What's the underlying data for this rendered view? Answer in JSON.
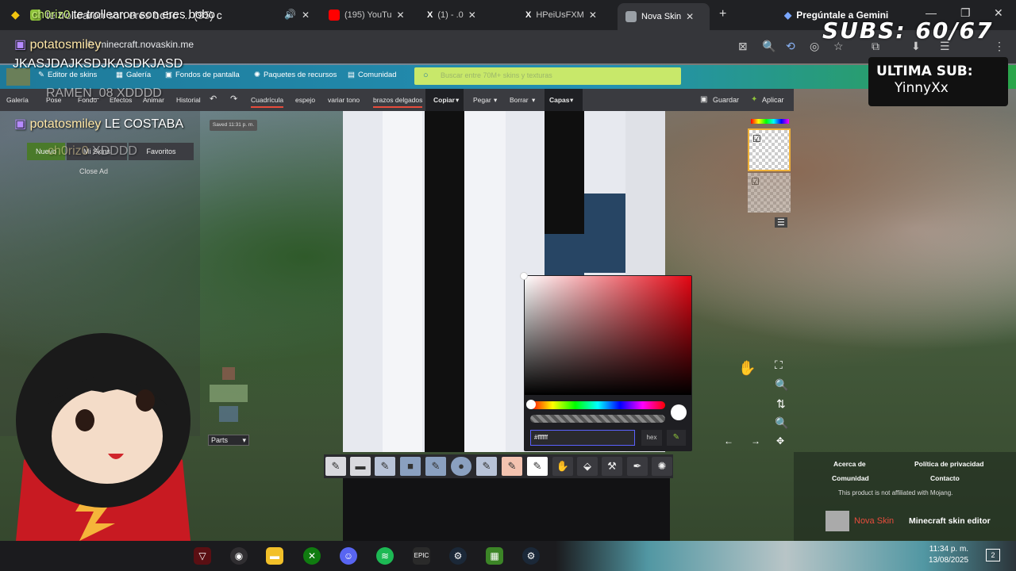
{
  "browser": {
    "tabs": [
      {
        "label": "te trollearon son eres bobo ... (95) c",
        "icon": "audio-tab-icon"
      },
      {
        "label": "(195) YouTu",
        "icon": "youtube-icon"
      },
      {
        "label": "(1) - .0",
        "icon": "x-icon"
      },
      {
        "label": "HPeiUsFXM",
        "icon": "x-icon"
      },
      {
        "label": "Nova Skin",
        "icon": "nova-skin-icon",
        "active": true
      },
      {
        "label": "Pregúntale a Gemini",
        "icon": "gemini-icon"
      }
    ],
    "url": "minecraft.novaskin.me"
  },
  "site_nav": {
    "items": [
      "Editor de skins",
      "Galería",
      "Fondos de pantalla",
      "Paquetes de recursos",
      "Comunidad"
    ],
    "search_placeholder": "Buscar entre 70M+ skins y texturas"
  },
  "editor_toolbar": {
    "left_items": [
      "Galería",
      "Pose",
      "Fondo",
      "Efectos",
      "Animar",
      "Historial"
    ],
    "undo": "↶",
    "redo": "↷",
    "items": [
      "Cuadrícula",
      "espejo",
      "variar tono",
      "brazos delgados"
    ],
    "menus": [
      "Copiar",
      "Pegar",
      "Borrar",
      "Capas"
    ],
    "save": "Guardar",
    "apply": "Aplicar"
  },
  "left_panel": {
    "saved": "Saved 11:31 p. m.",
    "tabs": [
      "Nuevo",
      "Mi Skins",
      "Favoritos"
    ],
    "close_ad": "Close Ad",
    "parts_select": "Parts"
  },
  "color_picker": {
    "hex_value": "#ffffff",
    "hex_label": "hex",
    "hue_color": "#e30613"
  },
  "footer": {
    "links": [
      "Acerca de",
      "Política de privacidad",
      "Comunidad",
      "Contacto"
    ],
    "disclaimer": "This product is not affiliated with Mojang.",
    "brand": "Nova Skin",
    "tagline": "Minecraft skin editor"
  },
  "overlay": {
    "subs": "SUBS: 60/67",
    "last_sub_title": "ULTIMA SUB:",
    "last_sub_name": "YinnyXx",
    "chat": [
      {
        "user": "ch0riz0",
        "text": "te trollearon son eres bobo"
      },
      {
        "user": "potatosmiley",
        "text": ""
      },
      {
        "user": "",
        "text": "JKASJDAJKSDJKASDKJASD"
      },
      {
        "user": "",
        "text": "RAMEN_08 XDDDD"
      },
      {
        "user": "potatosmiley",
        "text": "LE COSTABA"
      },
      {
        "user": "ch0riz0",
        "text": "XDDDD"
      }
    ]
  },
  "taskbar": {
    "apps": [
      "msi-icon",
      "obs-icon",
      "folder-icon",
      "xbox-icon",
      "discord-icon",
      "spotify-icon",
      "epic-icon",
      "steam-icon",
      "minecraft-icon",
      "steam-icon"
    ],
    "time": "11:34 p. m.",
    "date": "13/08/2025",
    "notifications": "2"
  }
}
